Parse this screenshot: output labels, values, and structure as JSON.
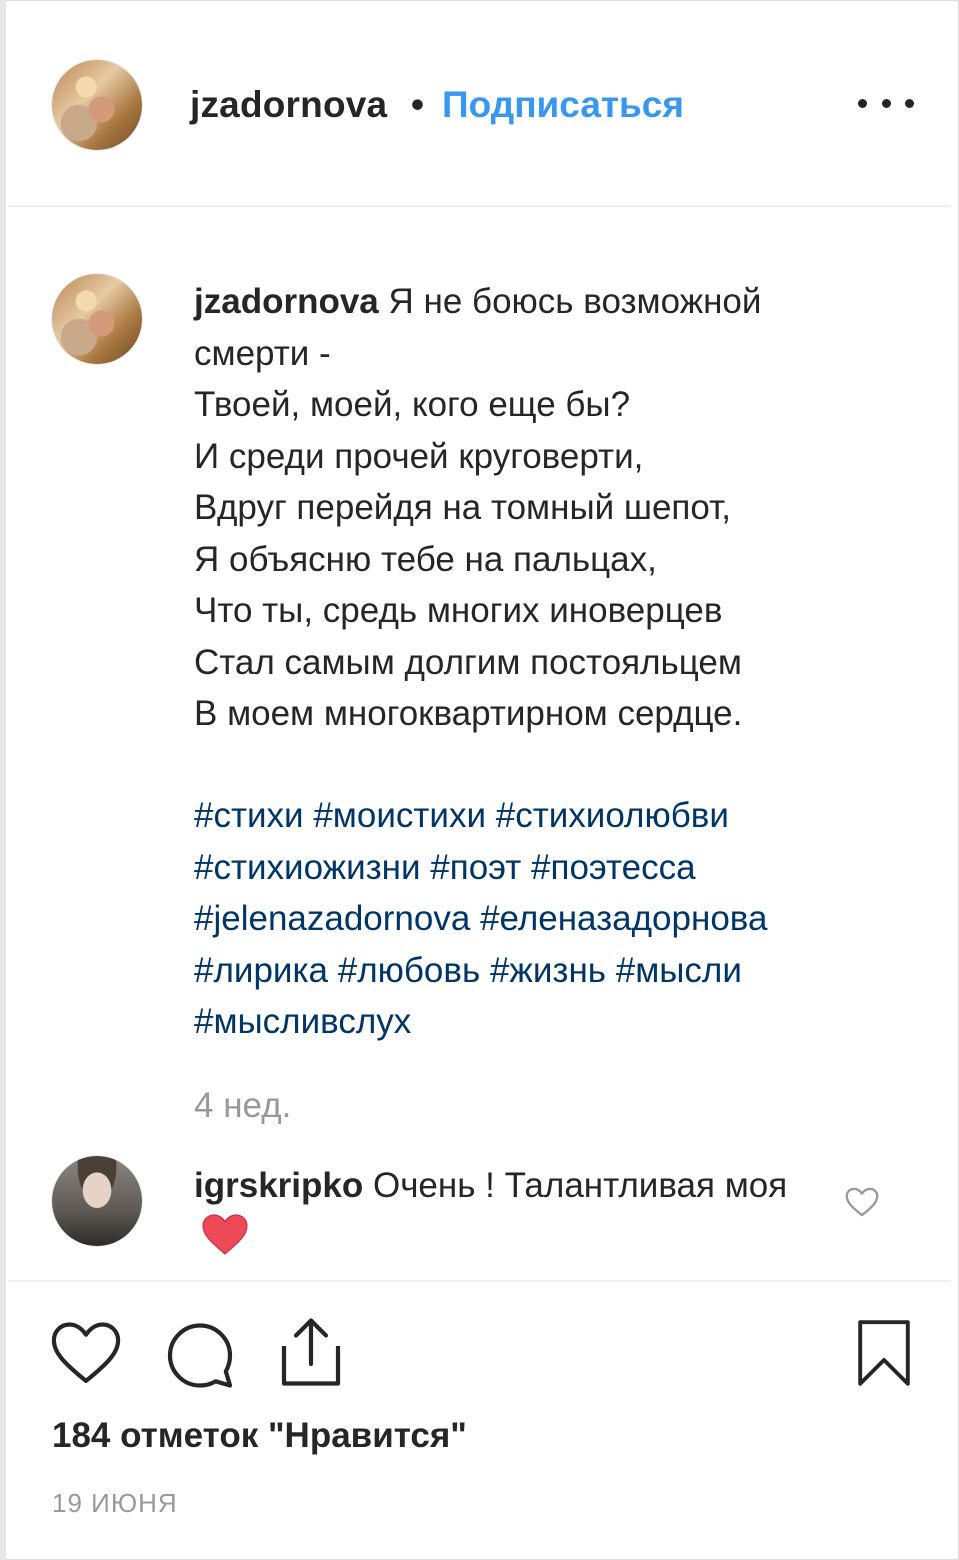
{
  "post": {
    "author": "jzadornova",
    "separator": "•",
    "follow_label": "Подписаться",
    "more_icon": "more-horizontal-icon"
  },
  "caption": {
    "author": "jzadornova",
    "first_line": "Я не боюсь возможной",
    "rest": "смерти -\nТвоей, моей, кого еще бы?\nИ среди прочей круговерти,\nВдруг перейдя на томный шепот,\nЯ объясню тебе на пальцах,\nЧто ты, средь многих иноверцев\nСтал самым долгим постояльцем\nВ моем многоквартирном сердце."
  },
  "hashtags": [
    "#стихи",
    "#моистихи",
    "#стихиолюбви",
    "#стихиожизни",
    "#поэт",
    "#поэтесса",
    "#jelenazadornova",
    "#еленазадорнова",
    "#лирика",
    "#любовь",
    "#жизнь",
    "#мысли",
    "#мысливслух"
  ],
  "post_age": "4 нед.",
  "comment": {
    "author": "igrskripko",
    "text": "Очень ! Талантливая моя",
    "emoji": "❤️",
    "like_icon": "heart-outline-icon"
  },
  "actions": {
    "like_icon": "heart-outline-icon",
    "comment_icon": "comment-bubble-icon",
    "share_icon": "share-upload-icon",
    "save_icon": "bookmark-icon"
  },
  "likes_text": "184 отметок \"Нравится\"",
  "date": "19 ИЮНЯ",
  "colors": {
    "link_blue": "#3897f0",
    "hashtag": "#003569",
    "text": "#262626",
    "muted": "#999999",
    "heart_red": "#ed4956"
  }
}
